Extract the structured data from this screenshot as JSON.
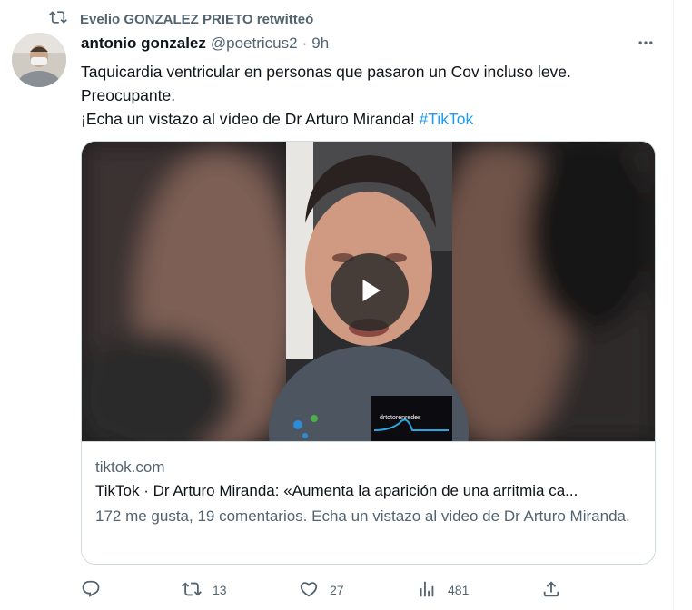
{
  "retweet": {
    "icon": "retweet-icon",
    "text": "Evelio GONZALEZ PRIETO retwitteó"
  },
  "tweet": {
    "author_name": "antonio gonzalez",
    "handle": "@poetricus2",
    "separator": "·",
    "time": "9h",
    "text_lines": [
      "Taquicardia ventricular en personas que pasaron un Cov incluso leve.",
      "Preocupante.",
      "¡Echa un vistazo al vídeo de Dr Arturo Miranda! "
    ],
    "hashtag": "#TikTok"
  },
  "card": {
    "watermark": "drtotorenredes",
    "domain": "tiktok.com",
    "title": "TikTok · Dr Arturo Miranda: «Aumenta la aparición de una arritmia ca...",
    "description": "172 me gusta, 19 comentarios. Echa un vistazo al video de Dr Arturo Miranda."
  },
  "actions": {
    "reply": {
      "icon": "reply-icon",
      "count": ""
    },
    "retweet": {
      "icon": "retweet-icon",
      "count": "13"
    },
    "like": {
      "icon": "heart-icon",
      "count": "27"
    },
    "views": {
      "icon": "views-chart-icon",
      "count": "481"
    },
    "share": {
      "icon": "share-icon",
      "count": ""
    }
  },
  "colors": {
    "accent": "#1d9bf0",
    "secondary_text": "#536471",
    "border": "#cfd9de"
  }
}
